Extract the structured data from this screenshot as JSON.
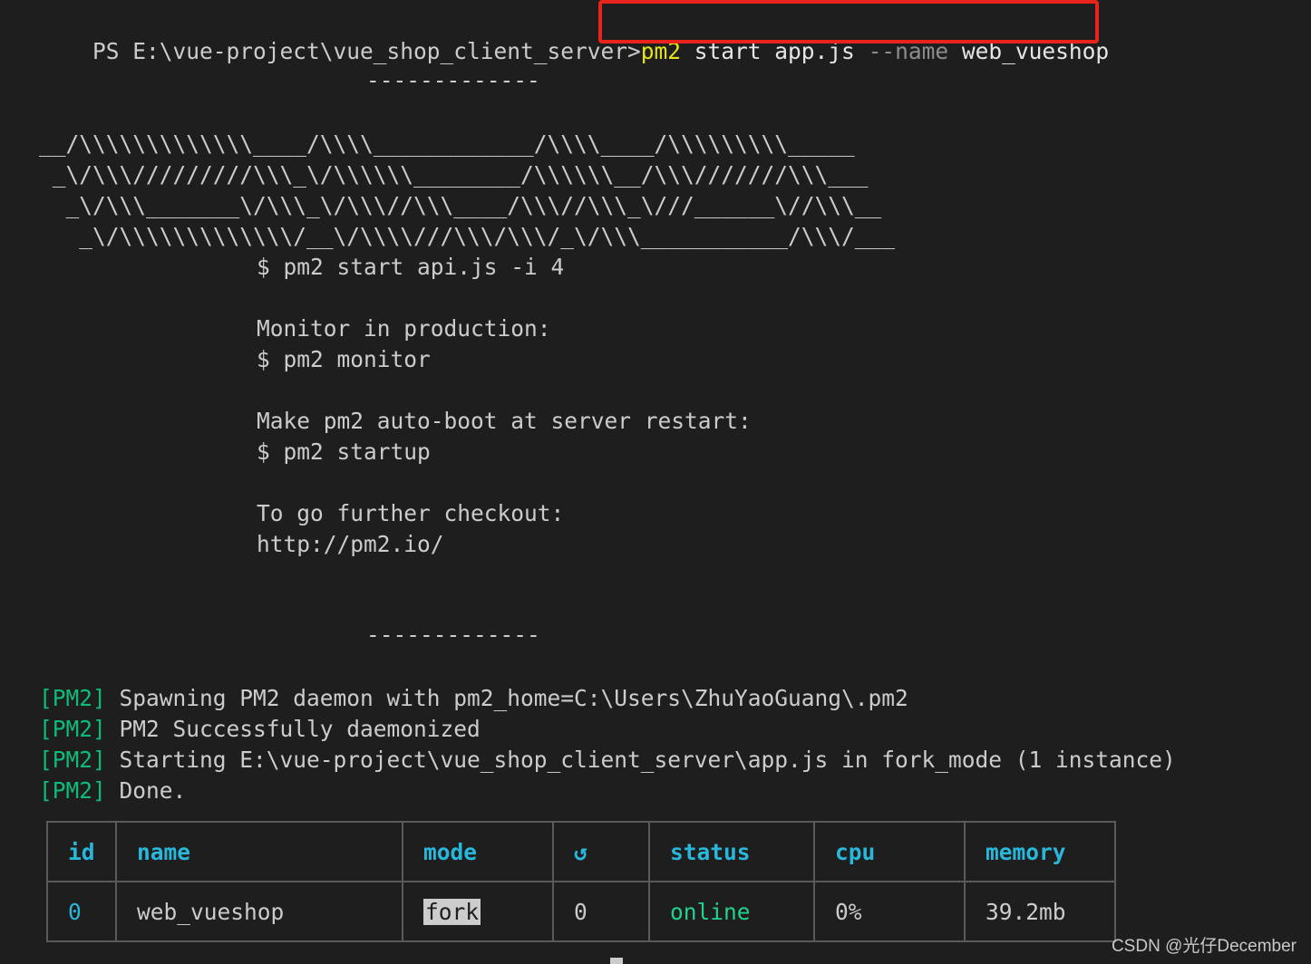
{
  "prompt": "PS E:\\vue-project\\vue_shop_client_server>",
  "command": {
    "program": "pm2",
    "args": " start app.js ",
    "flag": "--name",
    "value": " web_vueshop"
  },
  "separator_top": "-------------",
  "banner": [
    "__/\\\\\\\\\\\\\\\\\\\\\\\\\\____/\\\\\\\\____________/\\\\\\\\____/\\\\\\\\\\\\\\\\\\_____",
    " _\\/\\\\\\/////////\\\\\\_\\/\\\\\\\\\\\\________/\\\\\\\\\\\\__/\\\\\\///////\\\\\\___",
    "  _\\/\\\\\\_______\\/\\\\\\_\\/\\\\\\//\\\\\\____/\\\\\\//\\\\\\_\\///______\\//\\\\\\__",
    "   _\\/\\\\\\\\\\\\\\\\\\\\\\\\\\/__\\/\\\\\\\\///\\\\\\/\\\\\\/_\\/\\\\\\___________/\\\\\\/___"
  ],
  "help": [
    "$ pm2 start api.js -i 4",
    "",
    "Monitor in production:",
    "$ pm2 monitor",
    "",
    "Make pm2 auto-boot at server restart:",
    "$ pm2 startup",
    "",
    "To go further checkout:",
    "http://pm2.io/"
  ],
  "separator_bottom": "-------------",
  "logs": [
    {
      "tag": "[PM2]",
      "text": " Spawning PM2 daemon with pm2_home=C:\\Users\\ZhuYaoGuang\\.pm2"
    },
    {
      "tag": "[PM2]",
      "text": " PM2 Successfully daemonized"
    },
    {
      "tag": "[PM2]",
      "text": " Starting E:\\vue-project\\vue_shop_client_server\\app.js in fork_mode (1 instance)"
    },
    {
      "tag": "[PM2]",
      "text": " Done."
    }
  ],
  "table": {
    "headers": [
      "id",
      "name",
      "mode",
      "↺",
      "status",
      "cpu",
      "memory"
    ],
    "row": {
      "id": "0",
      "name": "web_vueshop",
      "mode": "fork",
      "restarts": "0",
      "status": "online",
      "cpu": "0%",
      "memory": "39.2mb"
    }
  },
  "watermark": "CSDN @光仔December",
  "colors": {
    "background": "#1e1e1e",
    "highlight_box": "#e8241c",
    "pm2_tag": "#0dbc79",
    "header": "#29b8db",
    "online": "#23d18b",
    "command": "#e5e510"
  }
}
